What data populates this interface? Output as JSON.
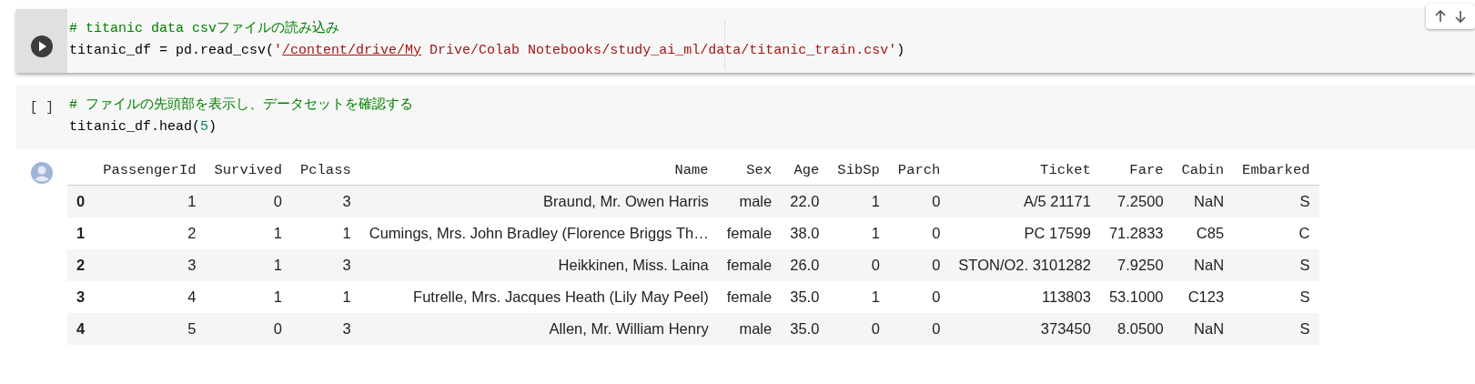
{
  "cells": [
    {
      "selected": true,
      "lines": [
        [
          {
            "kind": "comment",
            "text": "# titanic data csvファイルの読み込み"
          }
        ],
        [
          {
            "kind": "plain",
            "text": "titanic_df = pd.read_csv("
          },
          {
            "kind": "string",
            "text": "'"
          },
          {
            "kind": "link",
            "text": "/content/drive/My"
          },
          {
            "kind": "string",
            "text": " Drive/Colab Notebooks/study_ai_ml/data/titanic_train.csv'"
          },
          {
            "kind": "plain",
            "text": ")"
          }
        ]
      ]
    },
    {
      "selected": false,
      "execution_label": "[ ]",
      "lines": [
        [
          {
            "kind": "comment",
            "text": "# ファイルの先頭部を表示し、データセットを確認する"
          }
        ],
        [
          {
            "kind": "plain",
            "text": "titanic_df.head("
          },
          {
            "kind": "number",
            "text": "5"
          },
          {
            "kind": "plain",
            "text": ")"
          }
        ]
      ]
    }
  ],
  "output": {
    "table": {
      "columns": [
        "",
        "PassengerId",
        "Survived",
        "Pclass",
        "Name",
        "Sex",
        "Age",
        "SibSp",
        "Parch",
        "Ticket",
        "Fare",
        "Cabin",
        "Embarked"
      ],
      "rows": [
        [
          "0",
          "1",
          "0",
          "3",
          "Braund, Mr. Owen Harris",
          "male",
          "22.0",
          "1",
          "0",
          "A/5 21171",
          "7.2500",
          "NaN",
          "S"
        ],
        [
          "1",
          "2",
          "1",
          "1",
          "Cumings, Mrs. John Bradley (Florence Briggs Th…",
          "female",
          "38.0",
          "1",
          "0",
          "PC 17599",
          "71.2833",
          "C85",
          "C"
        ],
        [
          "2",
          "3",
          "1",
          "3",
          "Heikkinen, Miss. Laina",
          "female",
          "26.0",
          "0",
          "0",
          "STON/O2. 3101282",
          "7.9250",
          "NaN",
          "S"
        ],
        [
          "3",
          "4",
          "1",
          "1",
          "Futrelle, Mrs. Jacques Heath (Lily May Peel)",
          "female",
          "35.0",
          "1",
          "0",
          "113803",
          "53.1000",
          "C123",
          "S"
        ],
        [
          "4",
          "5",
          "0",
          "3",
          "Allen, Mr. William Henry",
          "male",
          "35.0",
          "0",
          "0",
          "373450",
          "8.0500",
          "NaN",
          "S"
        ]
      ]
    }
  }
}
